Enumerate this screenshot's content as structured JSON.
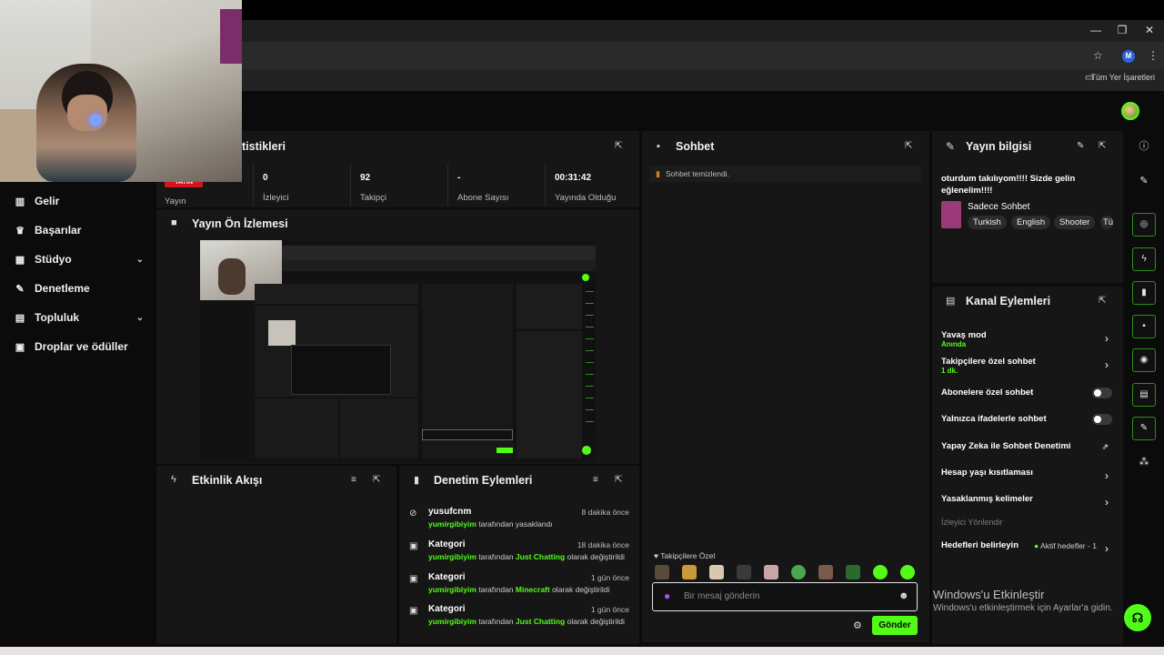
{
  "browser": {
    "window_controls": [
      "—",
      "❐",
      "✕"
    ],
    "bookmarks_label": "Tüm Yer İşaretleri",
    "profile_initial": "M"
  },
  "sidebar": {
    "items": [
      {
        "label": "Gelir",
        "icon": "bar-chart-icon"
      },
      {
        "label": "Başarılar",
        "icon": "trophy-icon"
      },
      {
        "label": "Stüdyo",
        "icon": "studio-icon",
        "expandable": true
      },
      {
        "label": "Denetleme",
        "icon": "wrench-icon"
      },
      {
        "label": "Topluluk",
        "icon": "community-icon",
        "expandable": true
      },
      {
        "label": "Droplar ve ödüller",
        "icon": "drops-icon"
      }
    ]
  },
  "stats": {
    "title": "tistikleri",
    "live_badge": "YAYIN",
    "first_label": "Yayın",
    "cells": [
      {
        "value": "0",
        "label": "İzleyici"
      },
      {
        "value": "92",
        "label": "Takipçi"
      },
      {
        "value": "-",
        "label": "Abone Sayısı"
      },
      {
        "value": "00:31:42",
        "label": "Yayında Olduğu"
      }
    ]
  },
  "preview": {
    "title": "Yayın Ön İzlemesi"
  },
  "activity": {
    "title": "Etkinlik Akışı"
  },
  "moderation": {
    "title": "Denetim Eylemleri",
    "rows": [
      {
        "name": "yusufcnm",
        "time": "8 dakika önce",
        "user": "yumirgibiyim",
        "middle": " tarafından yasaklandı",
        "highlight": "",
        "end": "",
        "icon": "ban-icon"
      },
      {
        "name": "Kategori",
        "time": "18 dakika önce",
        "user": "yumirgibiyim",
        "middle": " tarafından ",
        "highlight": "Just Chatting",
        "end": " olarak değiştirildi",
        "icon": "category-icon"
      },
      {
        "name": "Kategori",
        "time": "1 gün önce",
        "user": "yumirgibiyim",
        "middle": " tarafından ",
        "highlight": "Minecraft",
        "end": " olarak değiştirildi",
        "icon": "category-icon"
      },
      {
        "name": "Kategori",
        "time": "1 gün önce",
        "user": "yumirgibiyim",
        "middle": " tarafından ",
        "highlight": "Just Chatting",
        "end": " olarak değiştirildi",
        "icon": "category-icon"
      }
    ]
  },
  "chat": {
    "title": "Sohbet",
    "system_message": "Sohbet temizlendi.",
    "emote_section": "Takipçilere Özel",
    "placeholder": "Bir mesaj gönderin",
    "send_label": "Gönder"
  },
  "stream_info": {
    "title": "Yayın bilgisi",
    "stream_title": "oturdum takılıyom!!!! Sizde gelin eğlenelim!!!!",
    "category": "Sadece Sohbet",
    "tags": [
      "Turkish",
      "English",
      "Shooter",
      "Tü"
    ]
  },
  "channel_actions": {
    "title": "Kanal Eylemleri",
    "items": [
      {
        "label": "Yavaş mod",
        "sub": "Anında",
        "type": "chevron"
      },
      {
        "label": "Takipçilere özel sohbet",
        "sub": "1 dk.",
        "type": "chevron"
      },
      {
        "label": "Abonelere özel sohbet",
        "sub": "",
        "type": "toggle"
      },
      {
        "label": "Yalnızca ifadelerle sohbet",
        "sub": "",
        "type": "toggle"
      },
      {
        "label": "Yapay Zeka ile Sohbet Denetimi",
        "sub": "",
        "type": "external"
      },
      {
        "label": "Hesap yaşı kısıtlaması",
        "sub": "",
        "type": "chevron"
      },
      {
        "label": "Yasaklanmış kelimeler",
        "sub": "",
        "type": "chevron"
      }
    ],
    "section_label": "İzleyici Yönlendir",
    "goals_label": "Hedefleri belirleyin",
    "goals_status": "Aktif hedefler - 1"
  },
  "watermark": {
    "line1": "Windows'u Etkinleştir",
    "line2": "Windows'u etkinleştirmek için Ayarlar'a gidin."
  },
  "colors": {
    "accent": "#53fc18",
    "panel": "#161617",
    "background": "#0b0b0c"
  }
}
